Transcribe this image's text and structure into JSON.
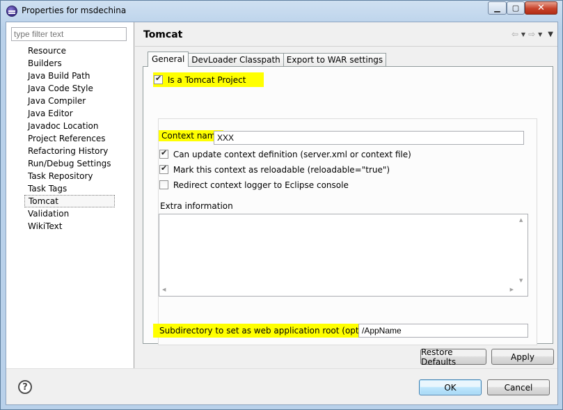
{
  "window": {
    "title": "Properties for msdechina"
  },
  "sidebar": {
    "filter_placeholder": "type filter text",
    "items": [
      {
        "label": "Resource"
      },
      {
        "label": "Builders"
      },
      {
        "label": "Java Build Path"
      },
      {
        "label": "Java Code Style"
      },
      {
        "label": "Java Compiler"
      },
      {
        "label": "Java Editor"
      },
      {
        "label": "Javadoc Location"
      },
      {
        "label": "Project References"
      },
      {
        "label": "Refactoring History"
      },
      {
        "label": "Run/Debug Settings"
      },
      {
        "label": "Task Repository"
      },
      {
        "label": "Task Tags"
      },
      {
        "label": "Tomcat",
        "selected": true
      },
      {
        "label": "Validation"
      },
      {
        "label": "WikiText"
      }
    ]
  },
  "page": {
    "title": "Tomcat",
    "nav": {
      "back_icon": "back-arrow-icon",
      "forward_icon": "forward-arrow-icon",
      "menu_icon": "view-menu-icon"
    }
  },
  "tabs": [
    {
      "label": "General",
      "active": true
    },
    {
      "label": "DevLoader Classpath",
      "active": false
    },
    {
      "label": "Export to WAR settings",
      "active": false
    }
  ],
  "general": {
    "is_tomcat_project": {
      "label": "Is a Tomcat Project",
      "checked": true
    },
    "context_name": {
      "label": "Context name",
      "value": "XXX"
    },
    "can_update": {
      "label": "Can update context definition (server.xml or context file)",
      "checked": true
    },
    "reloadable": {
      "label": "Mark this context as reloadable (reloadable=\"true\")",
      "checked": true
    },
    "redirect_logger": {
      "label": "Redirect context logger to Eclipse console",
      "checked": false
    },
    "extra_information": {
      "label": "Extra information",
      "value": ""
    },
    "subdirectory": {
      "label": "Subdirectory to set as web application root (optional)",
      "value": "/AppName"
    }
  },
  "buttons": {
    "restore_defaults": "Restore Defaults",
    "apply": "Apply",
    "ok": "OK",
    "cancel": "Cancel",
    "help": "?"
  },
  "colors": {
    "highlight": "#ffff00",
    "title_bar": "#b9d1ea",
    "close_button": "#c7422a"
  }
}
